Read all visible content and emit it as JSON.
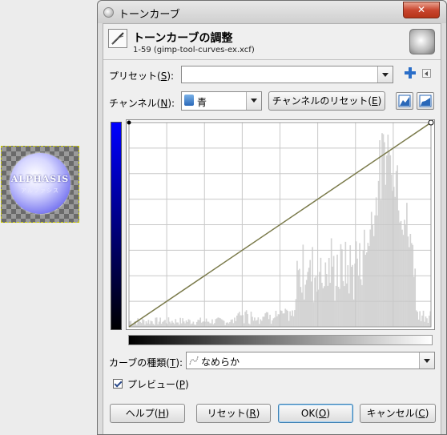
{
  "canvas": {
    "logo_text": "ALPHASIS",
    "logo_subtext": "アルファシス"
  },
  "window": {
    "title": "トーンカーブ",
    "close_label": "✕"
  },
  "header": {
    "title": "トーンカーブの調整",
    "subtitle": "1-59 (gimp-tool-curves-ex.xcf)"
  },
  "preset": {
    "label": "プリセット(",
    "mnemonic": "S",
    "label_end": "):",
    "value": ""
  },
  "channel": {
    "label": "チャンネル(",
    "mnemonic": "N",
    "label_end": "):",
    "value": "青",
    "reset_label": "チャンネルのリセット(",
    "reset_mnemonic": "E",
    "reset_end": ")"
  },
  "curve_type": {
    "label": "カーブの種類(",
    "mnemonic": "T",
    "label_end": "):",
    "value": "なめらか"
  },
  "preview": {
    "label": "プレビュー(",
    "mnemonic": "P",
    "label_end": ")",
    "checked": true
  },
  "buttons": {
    "help": "ヘルプ(",
    "help_m": "H",
    "help_e": ")",
    "reset": "リセット(",
    "reset_m": "R",
    "reset_e": ")",
    "ok": "OK(",
    "ok_m": "O",
    "ok_e": ")",
    "cancel": "キャンセル(",
    "cancel_m": "C",
    "cancel_e": ")"
  },
  "colors": {
    "curve": "#7a7a4a",
    "histogram": "#d4d4d4",
    "grid": "#c8c8c8",
    "channel_gradient_top": "#0000ff"
  },
  "icons": [
    "curves-tool-icon",
    "image-thumbnail-icon",
    "add-preset-icon",
    "preset-menu-icon",
    "channel-icon",
    "linear-histogram-icon",
    "log-histogram-icon",
    "smooth-curve-icon",
    "window-icon"
  ]
}
